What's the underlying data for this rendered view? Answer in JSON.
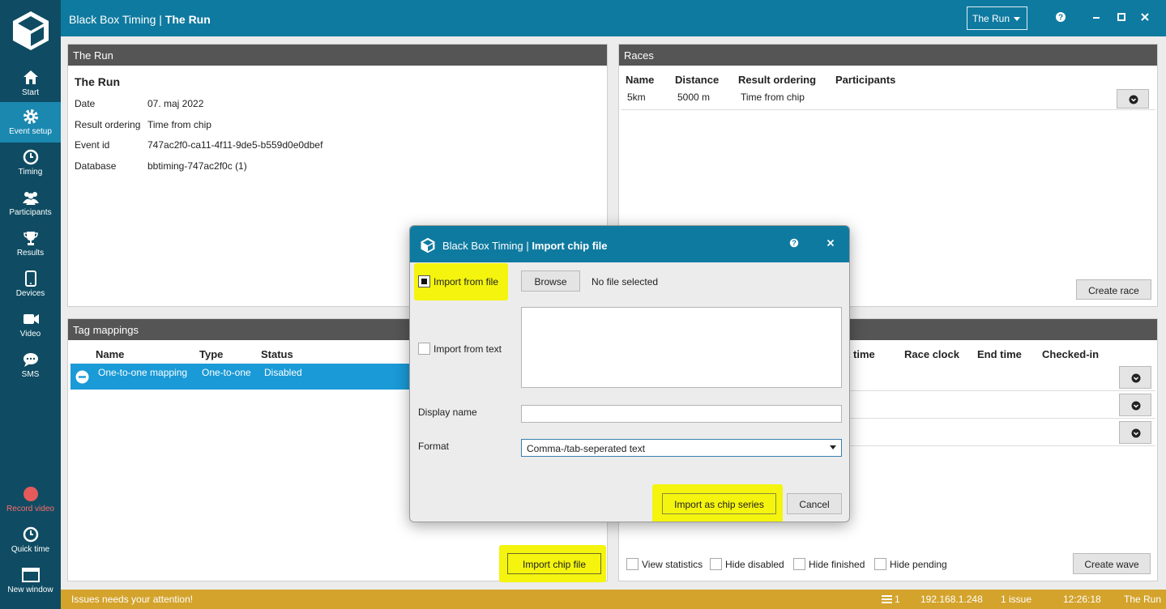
{
  "app": {
    "title_prefix": "Black Box Timing | ",
    "title_event": "The Run",
    "event_selector": "The Run"
  },
  "sidebar": {
    "items": [
      {
        "label": "Start",
        "icon": "home-icon"
      },
      {
        "label": "Event setup",
        "icon": "gear-icon",
        "active": true
      },
      {
        "label": "Timing",
        "icon": "clock-icon"
      },
      {
        "label": "Participants",
        "icon": "people-icon"
      },
      {
        "label": "Results",
        "icon": "trophy-icon"
      },
      {
        "label": "Devices",
        "icon": "tablet-icon"
      },
      {
        "label": "Video",
        "icon": "video-camera-icon"
      },
      {
        "label": "SMS",
        "icon": "chat-icon"
      }
    ],
    "bottom": [
      {
        "label": "Record video",
        "icon": "record-icon"
      },
      {
        "label": "Quick time",
        "icon": "clock-icon"
      },
      {
        "label": "New window",
        "icon": "window-icon"
      }
    ]
  },
  "event_panel": {
    "header": "The Run",
    "name": "The Run",
    "fields": [
      {
        "key": "Date",
        "value": "07. maj 2022"
      },
      {
        "key": "Result ordering",
        "value": "Time from chip"
      },
      {
        "key": "Event id",
        "value": "747ac2f0-ca11-4f11-9de5-b559d0e0dbef"
      },
      {
        "key": "Database",
        "value": "bbtiming-747ac2f0c (1)"
      }
    ]
  },
  "races_panel": {
    "header": "Races",
    "columns": [
      "Name",
      "Distance",
      "Result ordering",
      "Participants"
    ],
    "rows": [
      {
        "name": "5km",
        "distance": "5000 m",
        "ordering": "Time from chip",
        "participants": ""
      }
    ],
    "create_button": "Create race"
  },
  "tags_panel": {
    "header": "Tag mappings",
    "columns": [
      "Name",
      "Type",
      "Status"
    ],
    "rows": [
      {
        "name": "One-to-one mapping",
        "type": "One-to-one",
        "status": "Disabled"
      }
    ],
    "import_button": "Import chip file"
  },
  "waves_panel": {
    "columns": [
      "rt time",
      "Race clock",
      "End time",
      "Checked-in"
    ],
    "create_button": "Create wave",
    "options": [
      "View statistics",
      "Hide disabled",
      "Hide finished",
      "Hide pending"
    ]
  },
  "statusbar": {
    "message": "Issues needs your attention!",
    "devices": "1",
    "ip": "192.168.1.248",
    "issues": "1 issue",
    "time": "12:26:18",
    "event": "The Run"
  },
  "dialog": {
    "title_prefix": "Black Box Timing | ",
    "title": "Import chip file",
    "import_from_file": "Import from file",
    "browse": "Browse",
    "file_status": "No file selected",
    "import_from_text": "Import from text",
    "text_value": "",
    "display_name_label": "Display name",
    "display_name_value": "",
    "format_label": "Format",
    "format_value": "Comma-/tab-seperated text",
    "import_button": "Import as chip series",
    "cancel_button": "Cancel"
  },
  "colors": {
    "sidebar": "#0f4c63",
    "topbar": "#0f7aa0",
    "active_nav": "#1b88b0",
    "panel_header": "#555555",
    "selected_row": "#1a9ad6",
    "statusbar": "#d3a32c",
    "highlight": "#f4f40e"
  }
}
